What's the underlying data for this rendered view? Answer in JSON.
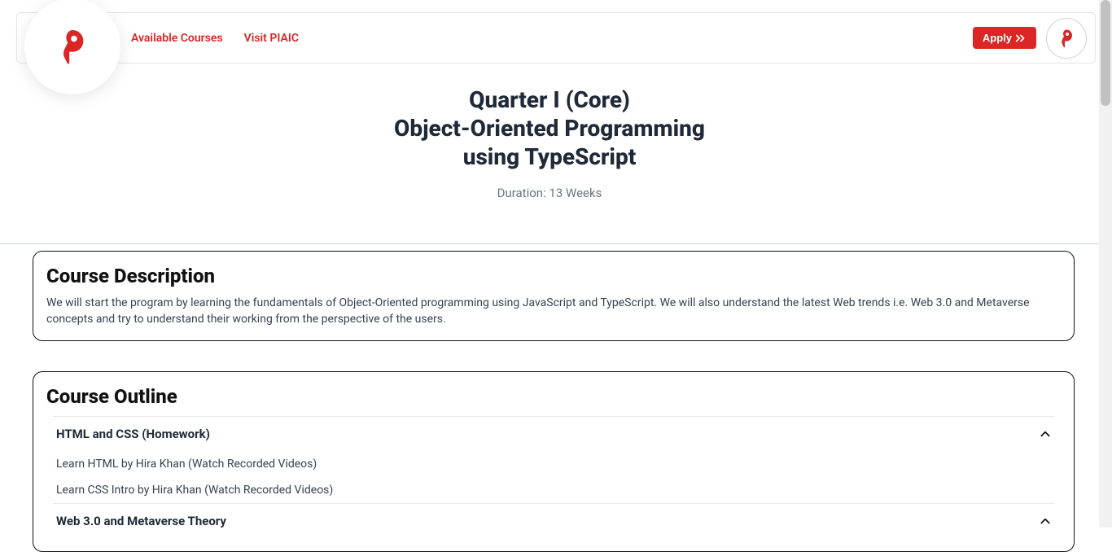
{
  "nav": {
    "links": [
      {
        "label": "Available Courses"
      },
      {
        "label": "Visit PIAIC"
      }
    ],
    "apply_label": "Apply"
  },
  "hero": {
    "title_line1": "Quarter I (Core)",
    "title_line2": "Object-Oriented Programming",
    "title_line3": "using TypeScript",
    "duration": "Duration: 13 Weeks"
  },
  "description": {
    "heading": "Course Description",
    "body": "We will start the program by learning the fundamentals of Object-Oriented programming using JavaScript and TypeScript. We will also understand the latest Web trends i.e. Web 3.0 and Metaverse concepts and try to understand their working from the perspective of the users."
  },
  "outline": {
    "heading": "Course Outline",
    "sections": [
      {
        "title": "HTML and CSS (Homework)",
        "items": [
          "Learn HTML by Hira Khan (Watch Recorded Videos)",
          "Learn CSS Intro by Hira Khan (Watch Recorded Videos)"
        ]
      },
      {
        "title": "Web 3.0 and Metaverse Theory",
        "items": []
      }
    ]
  },
  "colors": {
    "brand_red": "#dc2626"
  }
}
